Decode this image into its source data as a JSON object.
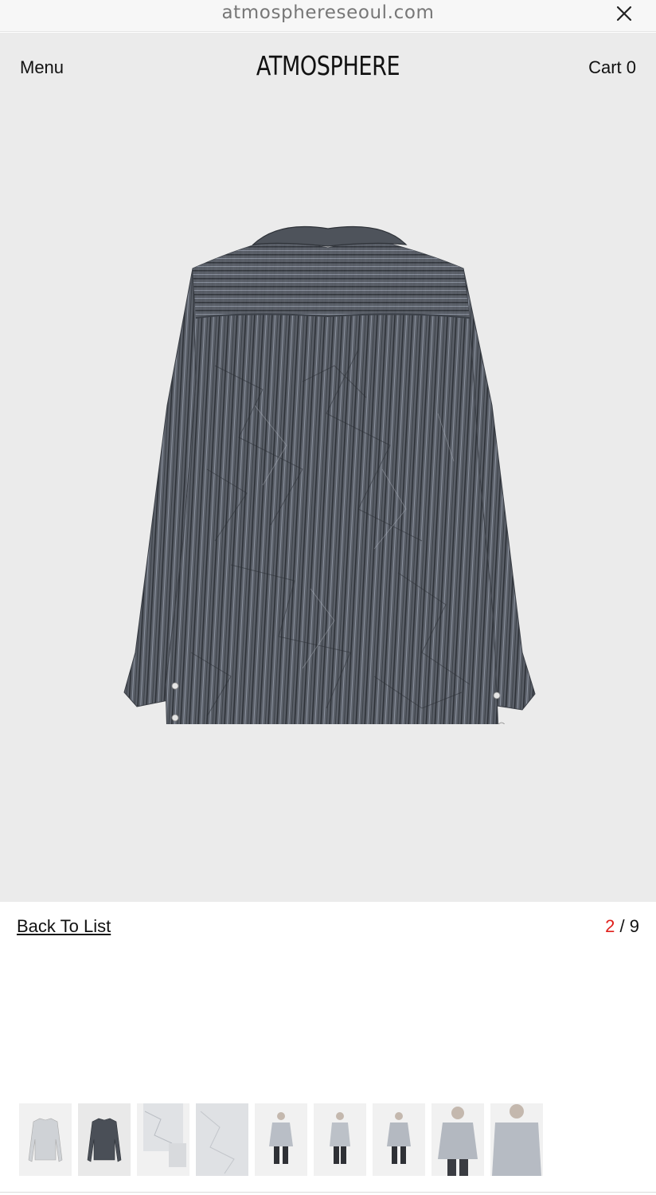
{
  "browser": {
    "url": "atmosphereseoul.com",
    "close_icon": "close-icon"
  },
  "header": {
    "menu_label": "Menu",
    "brand": "ATMOSPHERE",
    "cart_label": "Cart 0"
  },
  "product": {
    "image_description_icon": "striped-shirt-back-image",
    "image_bg": "#ebebeb",
    "shirt_color": "#555a62"
  },
  "pager": {
    "back_label": "Back To List",
    "current": "2",
    "separator": "/",
    "total": "9",
    "current_color": "#e0201b"
  },
  "thumbnails": {
    "count": 9,
    "active_index": 1
  }
}
